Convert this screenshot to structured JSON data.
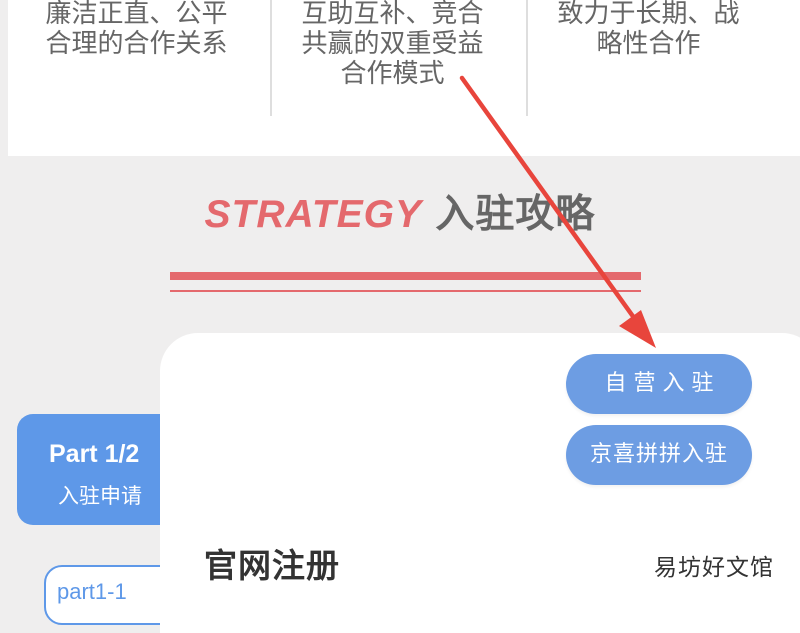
{
  "top_columns": [
    {
      "text": "廉洁正直、公平\n合理的合作关系"
    },
    {
      "text": "互助互补、竞合\n共赢的双重受益\n合作模式"
    },
    {
      "text": "致力于长期、战\n略性合作"
    }
  ],
  "strategy": {
    "title_en": "STRATEGY",
    "title_cn": "入驻攻略"
  },
  "part_card": {
    "title": "Part 1/2",
    "subtitle": "入驻申请"
  },
  "part_sub": {
    "label": "part1-1"
  },
  "buttons": {
    "self_operated": "自营入驻",
    "jingxi": "京喜拼拼入驻"
  },
  "section": {
    "heading": "官网注册"
  },
  "watermark": "易坊好文馆",
  "colors": {
    "accent_red": "#e4696d",
    "button_blue": "#6d9de3",
    "card_blue": "#5e98e8",
    "arrow_red": "#e8453c"
  },
  "icons": {
    "arrow": "red-arrow-annotation"
  }
}
